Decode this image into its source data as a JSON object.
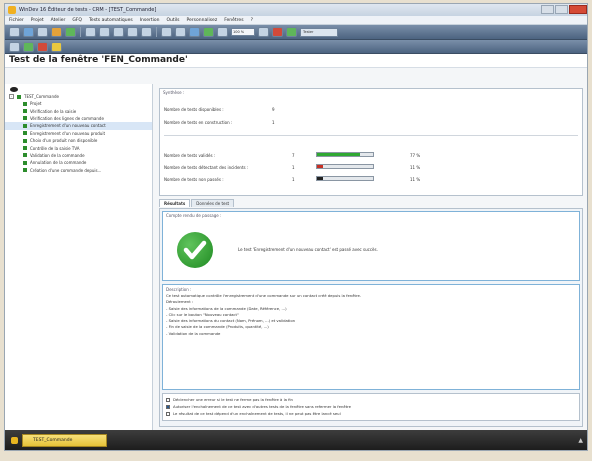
{
  "window": {
    "title": "WinDev 16 Éditeur de tests - CRM - [TEST_Commande]"
  },
  "menu": [
    "Fichier",
    "Projet",
    "Atelier",
    "GFQ",
    "Tests automatiques",
    "Insertion",
    "Outils",
    "Personnalisez",
    "Fenêtres",
    "?"
  ],
  "toolbar": {
    "zoom_value": "100 %",
    "test_label": "Tester"
  },
  "page": {
    "title": "Test de la fenêtre 'FEN_Commande'"
  },
  "tree": {
    "root": "TEST_Commande",
    "items": [
      "Projet",
      "Vérification de la saisie",
      "Vérification des lignes de commande",
      "Enregistrement d'un nouveau contact",
      "Enregistrement d'un nouveau produit",
      "Choix d'un produit non disponible",
      "Contrôle de la saisie TVA",
      "Validation de la commande",
      "Annulation de la commande",
      "Création d'une commande depuis..."
    ],
    "selected_index": 3
  },
  "synthese": {
    "label": "Synthèse :",
    "available_label": "Nombre de tests disponibles :",
    "available_value": "9",
    "construction_label": "Nombre de tests en construction :",
    "construction_value": "1",
    "valid_label": "Nombre de tests validés :",
    "valid_value": "7",
    "valid_pct": "77 %",
    "valid_ratio": 0.77,
    "valid_color": "#2fa832",
    "failed_label": "Nombre de tests détectant des incidents :",
    "failed_value": "1",
    "failed_pct": "11 %",
    "failed_ratio": 0.11,
    "failed_color": "#c63025",
    "notpassed_label": "Nombre de tests non passés :",
    "notpassed_value": "1",
    "notpassed_pct": "11 %",
    "notpassed_ratio": 0.11,
    "notpassed_color": "#222222"
  },
  "tabs": [
    "Résultats",
    "Données de test"
  ],
  "compte_rendu": {
    "label": "Compte rendu de passage :",
    "message": "Le test 'Enregistrement d'un nouveau contact' est passé avec succès."
  },
  "description": {
    "label": "Description :",
    "lines": [
      "Ce test automatique contrôle l'enregistrement d'une commande sur un contact créé depuis la fenêtre.",
      "",
      "Déroulement :",
      "- Saisie des informations de la commande (Date, Référence, ...)",
      "- Clic sur le bouton \"Nouveau contact\"",
      "- Saisie des informations du contact (Nom, Prénom, ...) et validation",
      "- Fin de saisie de la commande (Produits, quantité, ...)",
      "- Validation de la commande"
    ]
  },
  "options": [
    {
      "label": "Déclencher une erreur si le test ne ferme pas la fenêtre à la fin",
      "checked": false
    },
    {
      "label": "Autoriser l'enchaînement de ce test avec d'autres tests de la fenêtre sans refermer la fenêtre",
      "checked": true
    },
    {
      "label": "Le résultat de ce test dépend d'un enchaînement de tests, il ne peut pas être lancé seul",
      "checked": false
    }
  ],
  "taskbar": {
    "tab_label": "TEST_Commande"
  }
}
